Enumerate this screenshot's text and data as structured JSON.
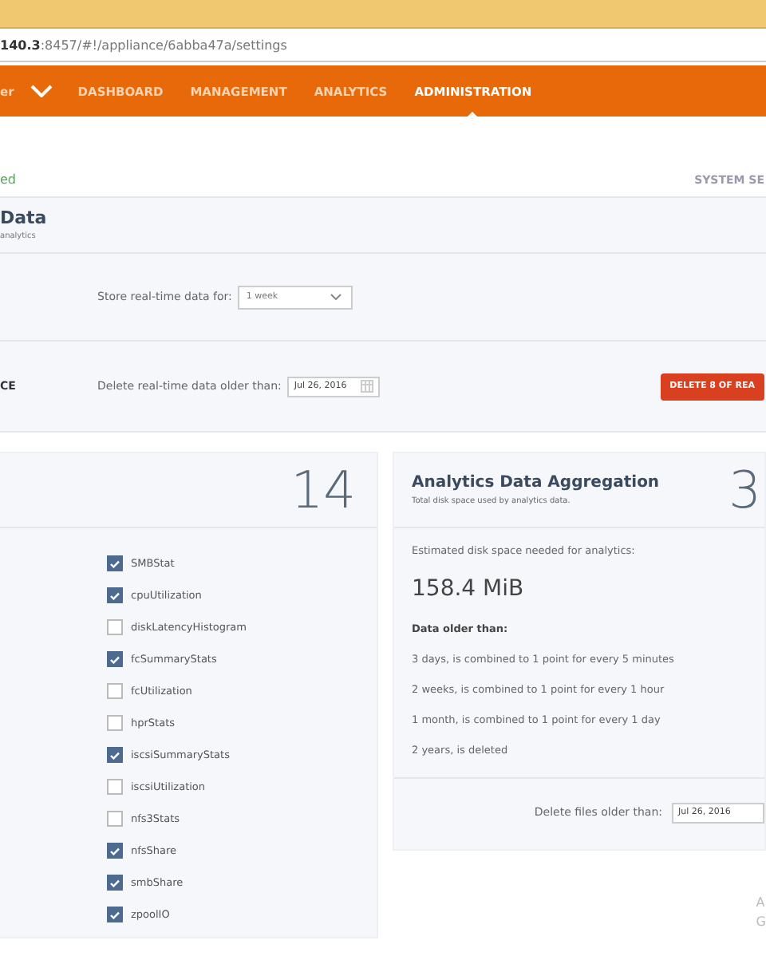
{
  "browser": {
    "address": "**140.3**:8457/#!/appliance/6abba47a/settings"
  },
  "nav": {
    "brand": "er",
    "items": [
      {
        "label": "DASHBOARD",
        "selected": false
      },
      {
        "label": "MANAGEMENT",
        "selected": false
      },
      {
        "label": "ANALYTICS",
        "selected": false
      },
      {
        "label": "ADMINISTRATION",
        "selected": true
      }
    ]
  },
  "status": {
    "text": "ed",
    "link": "SYSTEM SE"
  },
  "data_section": {
    "title": "Data",
    "subtitle": "analytics",
    "store_label": "Store real-time data for:",
    "store_value": "1 week",
    "maintenance_label": "CE",
    "delete_label": "Delete real-time data older than:",
    "delete_date": "Jul 26, 2016",
    "delete_button": "DELETE 8 OF REA"
  },
  "datasets_card": {
    "count": "14",
    "items": [
      {
        "label": "SMBStat",
        "checked": true
      },
      {
        "label": "cpuUtilization",
        "checked": true
      },
      {
        "label": "diskLatencyHistogram",
        "checked": false
      },
      {
        "label": "fcSummaryStats",
        "checked": true
      },
      {
        "label": "fcUtilization",
        "checked": false
      },
      {
        "label": "hprStats",
        "checked": false
      },
      {
        "label": "iscsiSummaryStats",
        "checked": true
      },
      {
        "label": "iscsiUtilization",
        "checked": false
      },
      {
        "label": "nfs3Stats",
        "checked": false
      },
      {
        "label": "nfsShare",
        "checked": true
      },
      {
        "label": "smbShare",
        "checked": true
      },
      {
        "label": "zpoolIO",
        "checked": true
      }
    ]
  },
  "aggregation_card": {
    "title": "Analytics Data Aggregation",
    "subtitle": "Total disk space used by analytics data.",
    "count": "3",
    "estimate_label": "Estimated disk space needed for analytics:",
    "estimate_value": "158.4 MiB",
    "rules_heading": "Data older than:",
    "rules": [
      "3 days, is combined to 1 point for every 5 minutes",
      "2 weeks, is combined to 1 point for every 1 hour",
      "1 month, is combined to 1 point for every 1 day",
      "2 years, is deleted"
    ],
    "delete_label": "Delete files older than:",
    "delete_date": "Jul 26, 2016"
  },
  "footer": [
    "A",
    "G"
  ]
}
